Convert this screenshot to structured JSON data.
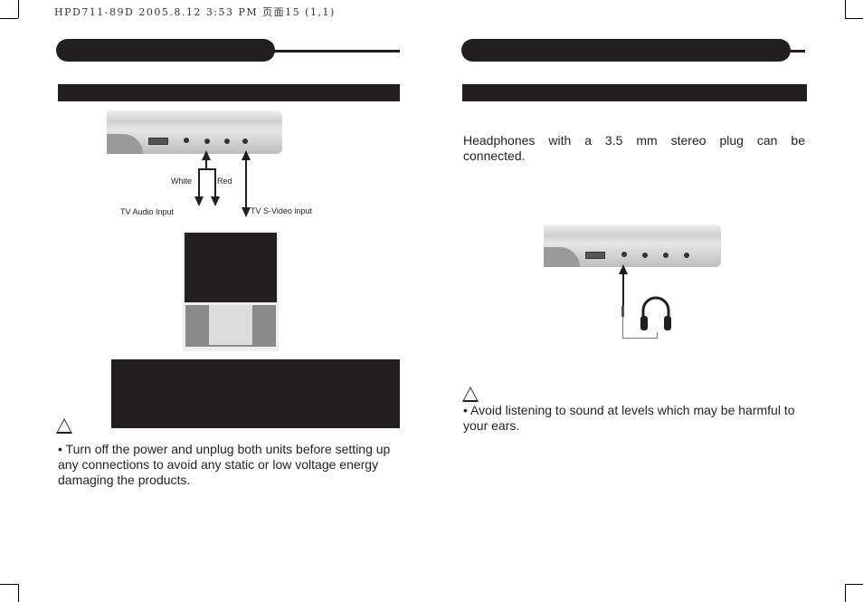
{
  "print_header": "HPD711-89D 2005.8.12 3:53 PM 页面15 (1,1)",
  "left_page": {
    "diagram": {
      "label_white": "White",
      "label_red": "Red",
      "label_audio": "TV Audio Input",
      "label_svideo": "TV S-Video input"
    },
    "caution_text": "• Turn off the power and unplug both units before setting up any connections to avoid any static or low voltage energy damaging the products."
  },
  "right_page": {
    "intro_text": "Headphones with a 3.5 mm stereo plug can be connected.",
    "caution_text": "• Avoid listening to sound at levels which may be harmful to your ears."
  }
}
